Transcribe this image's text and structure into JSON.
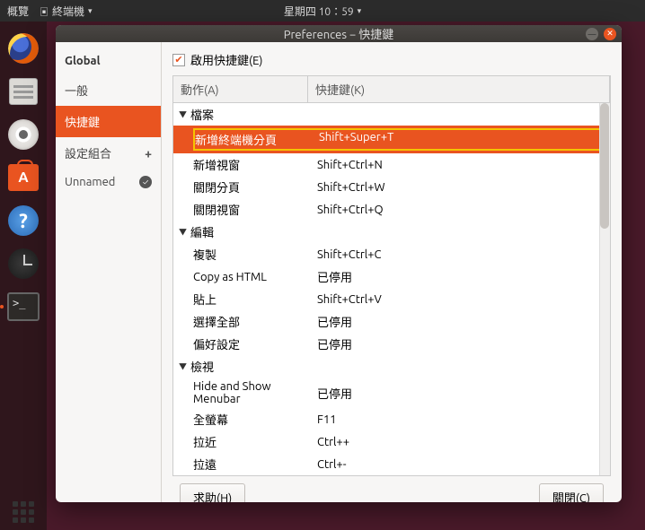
{
  "topbar": {
    "activities": "概覽",
    "app_menu": "終端機",
    "clock": "星期四 10：59"
  },
  "window": {
    "title": "Preferences − 快捷鍵"
  },
  "sidebar": {
    "header": "Global",
    "items": [
      {
        "label": "一般"
      },
      {
        "label": "快捷鍵"
      }
    ],
    "profile_header": "設定組合",
    "profiles": [
      {
        "label": "Unnamed"
      }
    ]
  },
  "main": {
    "enable_label": "啟用快捷鍵(E)",
    "columns": {
      "action": "動作(A)",
      "shortcut": "快捷鍵(K)"
    },
    "groups": [
      {
        "name": "檔案",
        "rows": [
          {
            "action": "新增終端機分頁",
            "key": "Shift+Super+T",
            "selected": true
          },
          {
            "action": "新增視窗",
            "key": "Shift+Ctrl+N"
          },
          {
            "action": "關閉分頁",
            "key": "Shift+Ctrl+W"
          },
          {
            "action": "關閉視窗",
            "key": "Shift+Ctrl+Q"
          }
        ]
      },
      {
        "name": "編輯",
        "rows": [
          {
            "action": "複製",
            "key": "Shift+Ctrl+C"
          },
          {
            "action": "Copy as HTML",
            "key": "已停用"
          },
          {
            "action": "貼上",
            "key": "Shift+Ctrl+V"
          },
          {
            "action": "選擇全部",
            "key": "已停用"
          },
          {
            "action": "偏好設定",
            "key": "已停用"
          }
        ]
      },
      {
        "name": "檢視",
        "rows": [
          {
            "action": "Hide and Show Menubar",
            "key": "已停用"
          },
          {
            "action": "全螢幕",
            "key": "F11"
          },
          {
            "action": "拉近",
            "key": "Ctrl++"
          },
          {
            "action": "拉遠",
            "key": "Ctrl+-"
          }
        ]
      }
    ]
  },
  "footer": {
    "help": "求助(H)",
    "close": "關閉(C)"
  }
}
